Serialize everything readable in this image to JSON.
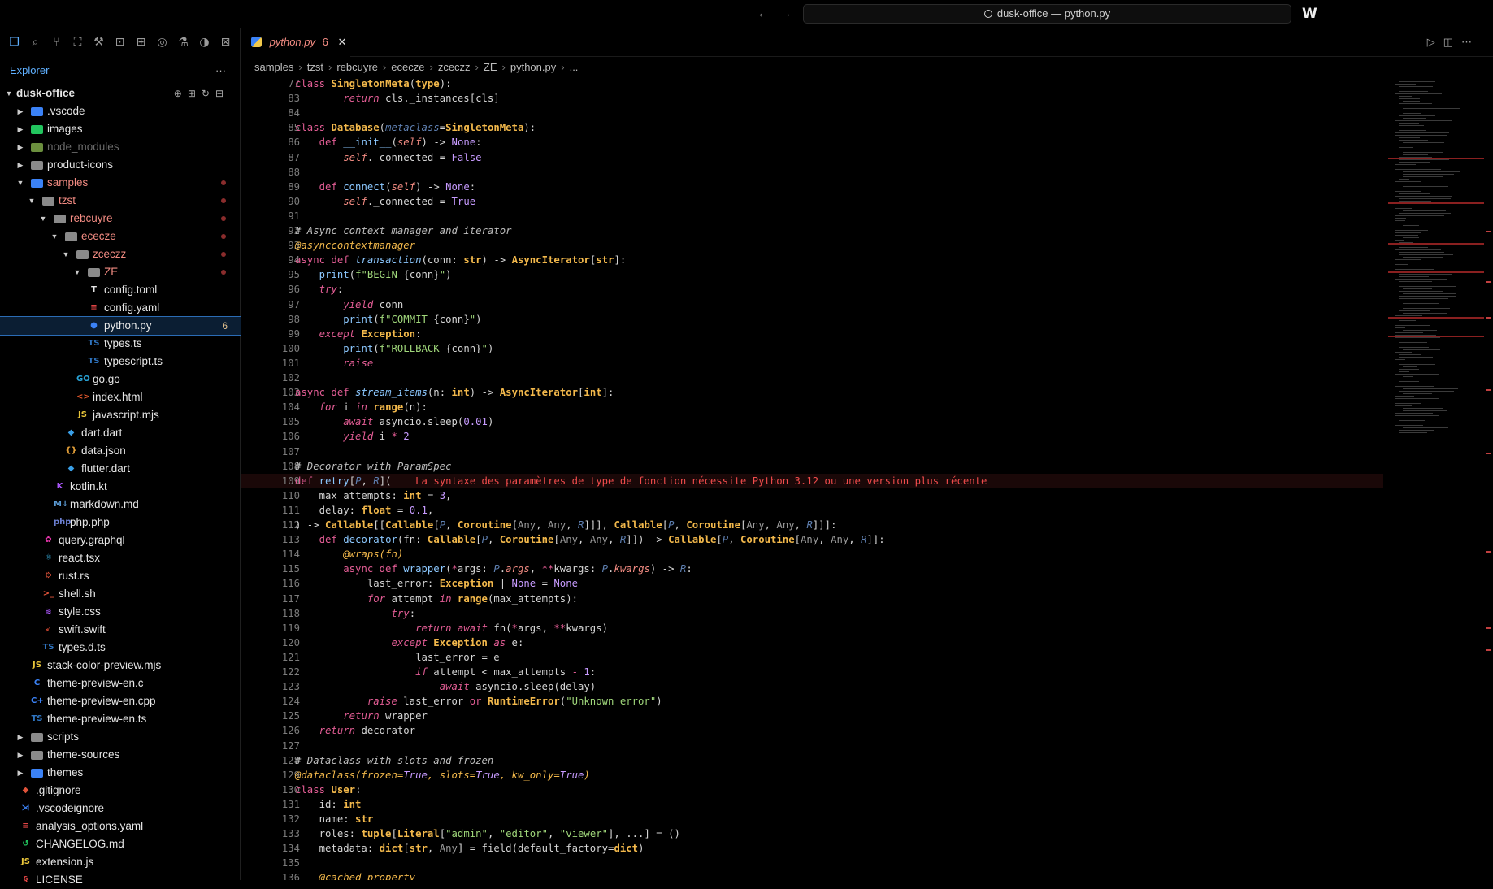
{
  "window": {
    "title": "dusk-office — python.py",
    "back_icon": "arrow-left-icon",
    "forward_icon": "arrow-right-icon",
    "logo": "W"
  },
  "activity_icons": [
    "files-icon",
    "search-icon",
    "source-control-icon",
    "map-icon",
    "debug-icon",
    "remote-icon",
    "extensions-icon",
    "accounts-icon",
    "testing-icon",
    "timeline-icon",
    "ports-icon"
  ],
  "explorer": {
    "title": "Explorer",
    "more": "···",
    "root": "dusk-office",
    "items": [
      {
        "label": "dusk-office",
        "depth": 0,
        "kind": "root",
        "twisty": "▼"
      },
      {
        "label": ".vscode",
        "depth": 1,
        "kind": "folder",
        "icon": "vscode-folder-icon",
        "color": "#3b82f6",
        "twisty": "▶"
      },
      {
        "label": "images",
        "depth": 1,
        "kind": "folder",
        "icon": "images-folder-icon",
        "color": "#22c55e",
        "twisty": "▶"
      },
      {
        "label": "node_modules",
        "depth": 1,
        "kind": "folder",
        "icon": "node-folder-icon",
        "color": "#6b8f3e",
        "twisty": "▶",
        "dim": true
      },
      {
        "label": "product-icons",
        "depth": 1,
        "kind": "folder",
        "icon": "folder-icon",
        "color": "#8a8a8a",
        "twisty": "▶"
      },
      {
        "label": "samples",
        "depth": 1,
        "kind": "folder",
        "icon": "samples-folder-icon",
        "color": "#3b82f6",
        "twisty": "▼",
        "modified": true
      },
      {
        "label": "tzst",
        "depth": 2,
        "kind": "folder",
        "icon": "folder-open-icon",
        "color": "#8a8a8a",
        "twisty": "▼",
        "modified": true
      },
      {
        "label": "rebcuyre",
        "depth": 3,
        "kind": "folder",
        "icon": "folder-open-icon",
        "color": "#8a8a8a",
        "twisty": "▼",
        "modified": true
      },
      {
        "label": "ececze",
        "depth": 4,
        "kind": "folder",
        "icon": "folder-open-icon",
        "color": "#8a8a8a",
        "twisty": "▼",
        "modified": true
      },
      {
        "label": "zceczz",
        "depth": 5,
        "kind": "folder",
        "icon": "folder-open-icon",
        "color": "#8a8a8a",
        "twisty": "▼",
        "modified": true
      },
      {
        "label": "ZE",
        "depth": 6,
        "kind": "folder",
        "icon": "folder-open-icon",
        "color": "#8a8a8a",
        "twisty": "▼",
        "modified": true
      },
      {
        "label": "config.toml",
        "depth": 7,
        "kind": "file",
        "icon": "toml-file-icon",
        "glyph": "T",
        "color": "#e6e6e6"
      },
      {
        "label": "config.yaml",
        "depth": 7,
        "kind": "file",
        "icon": "yaml-file-icon",
        "glyph": "≡",
        "color": "#e04444"
      },
      {
        "label": "python.py",
        "depth": 7,
        "kind": "file",
        "icon": "python-file-icon",
        "glyph": "●",
        "color": "#3b82f6",
        "selected": true,
        "badge": "6"
      },
      {
        "label": "types.ts",
        "depth": 7,
        "kind": "file",
        "icon": "typescript-file-icon",
        "glyph": "TS",
        "color": "#2f74c0"
      },
      {
        "label": "typescript.ts",
        "depth": 7,
        "kind": "file",
        "icon": "typescript-file-icon",
        "glyph": "TS",
        "color": "#2f74c0"
      },
      {
        "label": "go.go",
        "depth": 6,
        "kind": "file",
        "icon": "go-file-icon",
        "glyph": "GO",
        "color": "#29a3d6"
      },
      {
        "label": "index.html",
        "depth": 6,
        "kind": "file",
        "icon": "html-file-icon",
        "glyph": "<>",
        "color": "#e3572c"
      },
      {
        "label": "javascript.mjs",
        "depth": 6,
        "kind": "file",
        "icon": "javascript-file-icon",
        "glyph": "JS",
        "color": "#e8c53a"
      },
      {
        "label": "dart.dart",
        "depth": 5,
        "kind": "file",
        "icon": "dart-file-icon",
        "glyph": "◆",
        "color": "#3aa0e8"
      },
      {
        "label": "data.json",
        "depth": 5,
        "kind": "file",
        "icon": "json-file-icon",
        "glyph": "{}",
        "color": "#e8a33a"
      },
      {
        "label": "flutter.dart",
        "depth": 5,
        "kind": "file",
        "icon": "flutter-file-icon",
        "glyph": "◆",
        "color": "#3aa0e8"
      },
      {
        "label": "kotlin.kt",
        "depth": 4,
        "kind": "file",
        "icon": "kotlin-file-icon",
        "glyph": "K",
        "color": "#a855f7"
      },
      {
        "label": "markdown.md",
        "depth": 4,
        "kind": "file",
        "icon": "markdown-file-icon",
        "glyph": "M↓",
        "color": "#5b9bd5"
      },
      {
        "label": "php.php",
        "depth": 4,
        "kind": "file",
        "icon": "php-file-icon",
        "glyph": "php",
        "color": "#6b7fd1"
      },
      {
        "label": "query.graphql",
        "depth": 3,
        "kind": "file",
        "icon": "graphql-file-icon",
        "glyph": "✿",
        "color": "#e535ab"
      },
      {
        "label": "react.tsx",
        "depth": 3,
        "kind": "file",
        "icon": "react-file-icon",
        "glyph": "⚛",
        "color": "#3ab7e8"
      },
      {
        "label": "rust.rs",
        "depth": 3,
        "kind": "file",
        "icon": "rust-file-icon",
        "glyph": "⚙",
        "color": "#e0533a"
      },
      {
        "label": "shell.sh",
        "depth": 3,
        "kind": "file",
        "icon": "shell-file-icon",
        "glyph": ">_",
        "color": "#e0533a"
      },
      {
        "label": "style.css",
        "depth": 3,
        "kind": "file",
        "icon": "css-file-icon",
        "glyph": "≋",
        "color": "#a855f7"
      },
      {
        "label": "swift.swift",
        "depth": 3,
        "kind": "file",
        "icon": "swift-file-icon",
        "glyph": "➶",
        "color": "#f05138"
      },
      {
        "label": "types.d.ts",
        "depth": 3,
        "kind": "file",
        "icon": "typescript-def-file-icon",
        "glyph": "TS",
        "color": "#2f74c0"
      },
      {
        "label": "stack-color-preview.mjs",
        "depth": 2,
        "kind": "file",
        "icon": "javascript-file-icon",
        "glyph": "JS",
        "color": "#e8c53a"
      },
      {
        "label": "theme-preview-en.c",
        "depth": 2,
        "kind": "file",
        "icon": "c-file-icon",
        "glyph": "C",
        "color": "#3b82f6"
      },
      {
        "label": "theme-preview-en.cpp",
        "depth": 2,
        "kind": "file",
        "icon": "cpp-file-icon",
        "glyph": "C+",
        "color": "#3b82f6"
      },
      {
        "label": "theme-preview-en.ts",
        "depth": 2,
        "kind": "file",
        "icon": "typescript-file-icon",
        "glyph": "TS",
        "color": "#2f74c0"
      },
      {
        "label": "scripts",
        "depth": 1,
        "kind": "folder",
        "icon": "scripts-folder-icon",
        "color": "#8a8a8a",
        "twisty": "▶"
      },
      {
        "label": "theme-sources",
        "depth": 1,
        "kind": "folder",
        "icon": "folder-icon",
        "color": "#8a8a8a",
        "twisty": "▶"
      },
      {
        "label": "themes",
        "depth": 1,
        "kind": "folder",
        "icon": "themes-folder-icon",
        "color": "#3b82f6",
        "twisty": "▶"
      },
      {
        "label": ".gitignore",
        "depth": 1,
        "kind": "file",
        "icon": "git-file-icon",
        "glyph": "◆",
        "color": "#e0533a"
      },
      {
        "label": ".vscodeignore",
        "depth": 1,
        "kind": "file",
        "icon": "vscode-file-icon",
        "glyph": "⋊",
        "color": "#3b82f6"
      },
      {
        "label": "analysis_options.yaml",
        "depth": 1,
        "kind": "file",
        "icon": "yaml-file-icon",
        "glyph": "≡",
        "color": "#e04444"
      },
      {
        "label": "CHANGELOG.md",
        "depth": 1,
        "kind": "file",
        "icon": "changelog-file-icon",
        "glyph": "↺",
        "color": "#22c55e"
      },
      {
        "label": "extension.js",
        "depth": 1,
        "kind": "file",
        "icon": "javascript-file-icon",
        "glyph": "JS",
        "color": "#e8c53a"
      },
      {
        "label": "LICENSE",
        "depth": 1,
        "kind": "file",
        "icon": "license-file-icon",
        "glyph": "§",
        "color": "#e04444"
      }
    ]
  },
  "tab": {
    "name": "python.py",
    "problems": "6",
    "close": "✕"
  },
  "breadcrumb": [
    "samples",
    "tzst",
    "rebcuyre",
    "ececze",
    "zceczz",
    "ZE",
    "python.py",
    "..."
  ],
  "code": [
    {
      "n": "77",
      "html": "<span class='k'>class</span> <span class='cls'>SingletonMeta</span>(<span class='cls'>type</span>):"
    },
    {
      "n": "83",
      "html": "        <span class='kc'>return</span> cls._instances[cls]"
    },
    {
      "n": "84",
      "html": ""
    },
    {
      "n": "85",
      "html": "<span class='k'>class</span> <span class='cls'>Database</span>(<span class='tv'>metaclass</span>=<span class='cls'>SingletonMeta</span>):"
    },
    {
      "n": "86",
      "html": "    <span class='k'>def</span> <span class='f'>__init__</span>(<span class='slf'>self</span>) -> <span class='n'>None</span>:"
    },
    {
      "n": "87",
      "html": "        <span class='slf'>self</span>._connected = <span class='n'>False</span>"
    },
    {
      "n": "88",
      "html": ""
    },
    {
      "n": "89",
      "html": "    <span class='k'>def</span> <span class='f'>connect</span>(<span class='slf'>self</span>) -> <span class='n'>None</span>:"
    },
    {
      "n": "90",
      "html": "        <span class='slf'>self</span>._connected = <span class='n'>True</span>"
    },
    {
      "n": "91",
      "html": ""
    },
    {
      "n": "92",
      "html": "<span class='c'># Async context manager and iterator</span>"
    },
    {
      "n": "93",
      "html": "<span class='dec'>@asynccontextmanager</span>"
    },
    {
      "n": "94",
      "html": "<span class='k'>async def</span> <span class='fi'>transaction</span>(conn: <span class='cls'>str</span>) -> <span class='cls'>AsyncIterator</span>[<span class='cls'>str</span>]:"
    },
    {
      "n": "95",
      "html": "    <span class='f'>print</span>(<span class='s'>f\"BEGIN </span>{conn}<span class='s'>\"</span>)"
    },
    {
      "n": "96",
      "html": "    <span class='kc'>try</span>:"
    },
    {
      "n": "97",
      "html": "        <span class='kc'>yield</span> conn"
    },
    {
      "n": "98",
      "html": "        <span class='f'>print</span>(<span class='s'>f\"COMMIT </span>{conn}<span class='s'>\"</span>)"
    },
    {
      "n": "99",
      "html": "    <span class='kc'>except</span> <span class='cls'>Exception</span>:"
    },
    {
      "n": "100",
      "html": "        <span class='f'>print</span>(<span class='s'>f\"ROLLBACK </span>{conn}<span class='s'>\"</span>)"
    },
    {
      "n": "101",
      "html": "        <span class='kc'>raise</span>"
    },
    {
      "n": "102",
      "html": ""
    },
    {
      "n": "103",
      "html": "<span class='k'>async def</span> <span class='fi'>stream_items</span>(n: <span class='cls'>int</span>) -> <span class='cls'>AsyncIterator</span>[<span class='cls'>int</span>]:"
    },
    {
      "n": "104",
      "html": "    <span class='kc'>for</span> i <span class='kc'>in</span> <span class='cls'>range</span>(n):"
    },
    {
      "n": "105",
      "html": "        <span class='kc'>await</span> asyncio.sleep(<span class='n'>0.01</span>)"
    },
    {
      "n": "106",
      "html": "        <span class='kc'>yield</span> i <span class='k'>*</span> <span class='n'>2</span>"
    },
    {
      "n": "107",
      "html": ""
    },
    {
      "n": "108",
      "html": "<span class='c'># Decorator with ParamSpec</span>"
    },
    {
      "n": "109",
      "err": true,
      "html": "<span class='k'>def</span> <span class='f'>retry</span>[<span class='tv'>P</span>, <span class='tv'>R</span>](    <span class='errmsg'>La syntaxe des paramètres de type de fonction nécessite Python 3.12 ou une version plus récente</span>"
    },
    {
      "n": "110",
      "html": "    max_attempts: <span class='cls'>int</span> = <span class='n'>3</span>,"
    },
    {
      "n": "111",
      "html": "    delay: <span class='cls'>float</span> = <span class='n'>0.1</span>,"
    },
    {
      "n": "112",
      "html": ") -> <span class='cls'>Callable</span>[[<span class='cls'>Callable</span>[<span class='tv'>P</span>, <span class='cls'>Coroutine</span>[<span class='p'>Any</span>, <span class='p'>Any</span>, <span class='tv'>R</span>]]], <span class='cls'>Callable</span>[<span class='tv'>P</span>, <span class='cls'>Coroutine</span>[<span class='p'>Any</span>, <span class='p'>Any</span>, <span class='tv'>R</span>]]]:"
    },
    {
      "n": "113",
      "html": "    <span class='k'>def</span> <span class='f'>decorator</span>(fn: <span class='cls'>Callable</span>[<span class='tv'>P</span>, <span class='cls'>Coroutine</span>[<span class='p'>Any</span>, <span class='p'>Any</span>, <span class='tv'>R</span>]]) -> <span class='cls'>Callable</span>[<span class='tv'>P</span>, <span class='cls'>Coroutine</span>[<span class='p'>Any</span>, <span class='p'>Any</span>, <span class='tv'>R</span>]]:"
    },
    {
      "n": "114",
      "html": "        <span class='dec'>@wraps(fn)</span>"
    },
    {
      "n": "115",
      "html": "        <span class='k'>async def</span> <span class='f'>wrapper</span>(<span class='k'>*</span>args: <span class='tv'>P</span>.<span class='kw'>args</span>, <span class='k'>**</span>kwargs: <span class='tv'>P</span>.<span class='kw'>kwargs</span>) -> <span class='tv'>R</span>:"
    },
    {
      "n": "116",
      "html": "            last_error: <span class='cls'>Exception</span> | <span class='n'>None</span> = <span class='n'>None</span>"
    },
    {
      "n": "117",
      "html": "            <span class='kc'>for</span> attempt <span class='kc'>in</span> <span class='cls'>range</span>(max_attempts):"
    },
    {
      "n": "118",
      "html": "                <span class='kc'>try</span>:"
    },
    {
      "n": "119",
      "html": "                    <span class='kc'>return await</span> fn(<span class='k'>*</span>args, <span class='k'>**</span>kwargs)"
    },
    {
      "n": "120",
      "html": "                <span class='kc'>except</span> <span class='cls'>Exception</span> <span class='kc'>as</span> e:"
    },
    {
      "n": "121",
      "html": "                    last_error = e"
    },
    {
      "n": "122",
      "html": "                    <span class='kc'>if</span> attempt &lt; max_attempts <span class='k'>-</span> <span class='n'>1</span>:"
    },
    {
      "n": "123",
      "html": "                        <span class='kc'>await</span> asyncio.sleep(delay)"
    },
    {
      "n": "124",
      "html": "            <span class='kc'>raise</span> last_error <span class='k'>or</span> <span class='cls'>RuntimeError</span>(<span class='s'>\"Unknown error\"</span>)"
    },
    {
      "n": "125",
      "html": "        <span class='kc'>return</span> wrapper"
    },
    {
      "n": "126",
      "html": "    <span class='kc'>return</span> decorator"
    },
    {
      "n": "127",
      "html": ""
    },
    {
      "n": "128",
      "html": "<span class='c'># Dataclass with slots and frozen</span>"
    },
    {
      "n": "129",
      "html": "<span class='dec'>@dataclass(frozen=</span><span class='n' style='font-style:italic'>True</span><span class='dec'>, slots=</span><span class='n' style='font-style:italic'>True</span><span class='dec'>, kw_only=</span><span class='n' style='font-style:italic'>True</span><span class='dec'>)</span>"
    },
    {
      "n": "130",
      "html": "<span class='k'>class</span> <span class='cls'>User</span>:"
    },
    {
      "n": "131",
      "html": "    id: <span class='cls'>int</span>"
    },
    {
      "n": "132",
      "html": "    name: <span class='cls'>str</span>"
    },
    {
      "n": "133",
      "html": "    roles: <span class='cls'>tuple</span>[<span class='cls'>Literal</span>[<span class='s'>\"admin\"</span>, <span class='s'>\"editor\"</span>, <span class='s'>\"viewer\"</span>], ...] = ()"
    },
    {
      "n": "134",
      "html": "    metadata: <span class='cls'>dict</span>[<span class='cls'>str</span>, <span class='p'>Any</span>] = field(default_factory=<span class='cls'>dict</span>)"
    },
    {
      "n": "135",
      "html": ""
    },
    {
      "n": "136",
      "html": "    <span class='dec'>@cached_property</span>"
    }
  ]
}
